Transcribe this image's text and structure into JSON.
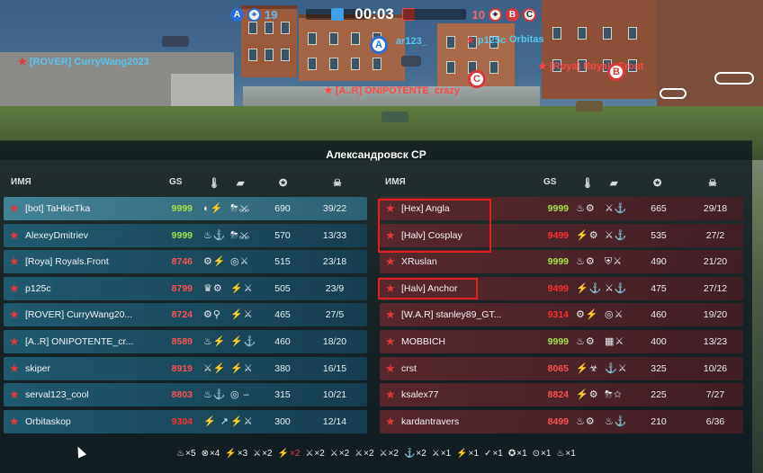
{
  "hud": {
    "blue_score": "19",
    "red_score": "10",
    "timer": "00:03",
    "blue_letter": "A",
    "red_letters": [
      "B",
      "C"
    ]
  },
  "world_labels": [
    {
      "text": "[ROVER] CurryWang2023",
      "team": "blue"
    },
    {
      "text": "[A..R] ONIPOTENTE_crazy",
      "team": "red"
    },
    {
      "text": "ar123_",
      "team": "blue"
    },
    {
      "text": "p125c",
      "team": "blue"
    },
    {
      "text": "Orbitas",
      "team": "blue"
    },
    {
      "text": "[Roya] Royals.Front",
      "team": "red"
    }
  ],
  "markers": [
    "A",
    "B",
    "C"
  ],
  "board": {
    "map_title": "Александровск CP",
    "headers": {
      "name": "ИМЯ",
      "gs": "GS"
    },
    "left_team": [
      {
        "rank": "★",
        "name": "[bot] TaHkicTka",
        "gs": "9999",
        "gs_color": "#a6e24a",
        "icons1": "◐⚡",
        "icons2": "⛈⚔",
        "score": "690",
        "kd": "39/22"
      },
      {
        "rank": "★",
        "name": "AlexeyDmitriev",
        "gs": "9999",
        "gs_color": "#a6e24a",
        "icons1": "♨⚓",
        "icons2": "⛈⚔",
        "score": "570",
        "kd": "13/33"
      },
      {
        "rank": "★",
        "name": "[Roya] Royals.Front",
        "gs": "8746",
        "gs_color": "#ff5252",
        "icons1": "⚙⚡",
        "icons2": "◎⚔",
        "score": "515",
        "kd": "23/18"
      },
      {
        "rank": "★",
        "name": "p125c",
        "gs": "8799",
        "gs_color": "#ff5252",
        "icons1": "♛⚙",
        "icons2": "⚡⚔",
        "score": "505",
        "kd": "23/9"
      },
      {
        "rank": "★",
        "name": "[ROVER] CurryWang20...",
        "gs": "8724",
        "gs_color": "#ff5252",
        "icons1": "⚙⚲",
        "icons2": "⚡⚔",
        "score": "465",
        "kd": "27/5"
      },
      {
        "rank": "★",
        "name": "[A..R] ONIPOTENTE_cr...",
        "gs": "8589",
        "gs_color": "#ff5252",
        "icons1": "♨⚡",
        "icons2": "⚡⚓",
        "score": "460",
        "kd": "18/20"
      },
      {
        "rank": "★",
        "name": "skiper",
        "gs": "8919",
        "gs_color": "#ff5252",
        "icons1": "⚔⚡",
        "icons2": "⚡⚔",
        "score": "380",
        "kd": "16/15"
      },
      {
        "rank": "★",
        "name": "serval123_cool",
        "gs": "8803",
        "gs_color": "#ff5252",
        "icons1": "♨⚓",
        "icons2": "◎ –",
        "score": "315",
        "kd": "10/21"
      },
      {
        "rank": "★",
        "name": "Orbitaskop",
        "gs": "9304",
        "gs_color": "#ff3030",
        "icons1": "⚡ ↗",
        "icons2": "⚡⚔",
        "score": "300",
        "kd": "12/14"
      }
    ],
    "right_team": [
      {
        "rank": "★",
        "name": "[Hex] Angla",
        "gs": "9999",
        "gs_color": "#a6e24a",
        "icons1": "♨⚙",
        "icons2": "⚔⚓",
        "score": "665",
        "kd": "29/18"
      },
      {
        "rank": "★",
        "name": "[Halv] Cosplay",
        "gs": "9499",
        "gs_color": "#ff3030",
        "icons1": "⚡⚙",
        "icons2": "⚔⚓",
        "score": "535",
        "kd": "27/2"
      },
      {
        "rank": "★",
        "name": "XRuslan",
        "gs": "9999",
        "gs_color": "#a6e24a",
        "icons1": "♨⚙",
        "icons2": "⛨⚔",
        "score": "490",
        "kd": "21/20"
      },
      {
        "rank": "★",
        "name": "[Halv] Anchor",
        "gs": "9499",
        "gs_color": "#ff3030",
        "icons1": "⚡⚓",
        "icons2": "⚔⚓",
        "score": "475",
        "kd": "27/12"
      },
      {
        "rank": "★",
        "name": "[W.A.R] stanley89_GT...",
        "gs": "9314",
        "gs_color": "#ff3030",
        "icons1": "⚙⚡",
        "icons2": "◎⚔",
        "score": "460",
        "kd": "19/20"
      },
      {
        "rank": "★",
        "name": "MOBBICH",
        "gs": "9999",
        "gs_color": "#a6e24a",
        "icons1": "♨⚙",
        "icons2": "▦⚔",
        "score": "400",
        "kd": "13/23"
      },
      {
        "rank": "★",
        "name": "crst",
        "gs": "8065",
        "gs_color": "#ff5252",
        "icons1": "⚡☣",
        "icons2": "⚓⚔",
        "score": "325",
        "kd": "10/26"
      },
      {
        "rank": "★",
        "name": "ksalex77",
        "gs": "8824",
        "gs_color": "#ff5252",
        "icons1": "⚡⚙",
        "icons2": "⛈☆",
        "score": "225",
        "kd": "7/27"
      },
      {
        "rank": "★",
        "name": "kardantravers",
        "gs": "8499",
        "gs_color": "#ff5252",
        "icons1": "♨⚙",
        "icons2": "♨⚓",
        "score": "210",
        "kd": "6/36"
      }
    ],
    "awards": [
      "×5",
      "×4",
      "×3",
      "×2",
      "×2",
      "×2",
      "×2",
      "×2",
      "×2",
      "×2",
      "×1",
      "×1",
      "×1",
      "×1",
      "×1",
      "×1"
    ]
  },
  "colors": {
    "accent_blue": "#2b6fd6",
    "accent_red": "#d83838",
    "gs_green": "#a6e24a",
    "highlight_box": "#e02020"
  }
}
